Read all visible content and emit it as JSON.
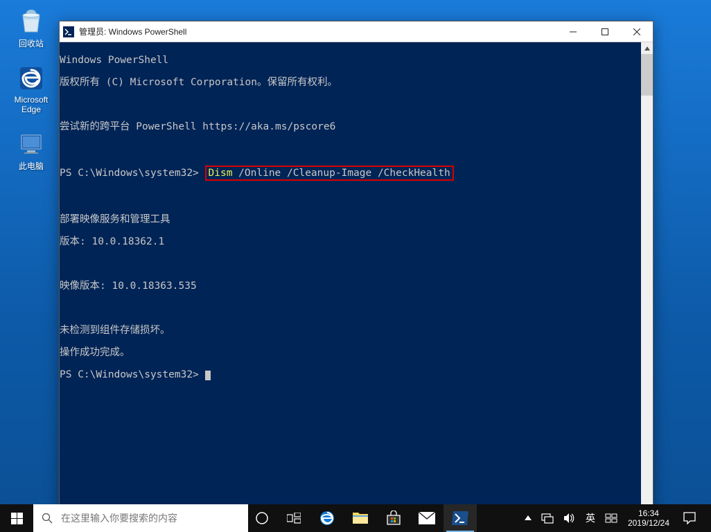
{
  "desktop": {
    "icons": [
      {
        "name": "recycle-bin-icon",
        "label": "回收站"
      },
      {
        "name": "edge-icon",
        "label": "Microsoft Edge"
      },
      {
        "name": "this-pc-icon",
        "label": "此电脑"
      }
    ]
  },
  "window": {
    "title": "管理员: Windows PowerShell",
    "terminal": {
      "line1": "Windows PowerShell",
      "line2": "版权所有 (C) Microsoft Corporation。保留所有权利。",
      "line3": "尝试新的跨平台 PowerShell https://aka.ms/pscore6",
      "prompt1": "PS C:\\Windows\\system32> ",
      "cmd_dism": "Dism",
      "cmd_args": " /Online /Cleanup-Image /CheckHealth",
      "line_dism_tool": "部署映像服务和管理工具",
      "line_version": "版本: 10.0.18362.1",
      "line_image_version": "映像版本: 10.0.18363.535",
      "line_nocorrupt": "未检测到组件存储损坏。",
      "line_success": "操作成功完成。",
      "prompt2": "PS C:\\Windows\\system32> "
    }
  },
  "taskbar": {
    "search_placeholder": "在这里输入你要搜索的内容",
    "ime": "英",
    "clock_time": "16:34",
    "clock_date": "2019/12/24"
  }
}
